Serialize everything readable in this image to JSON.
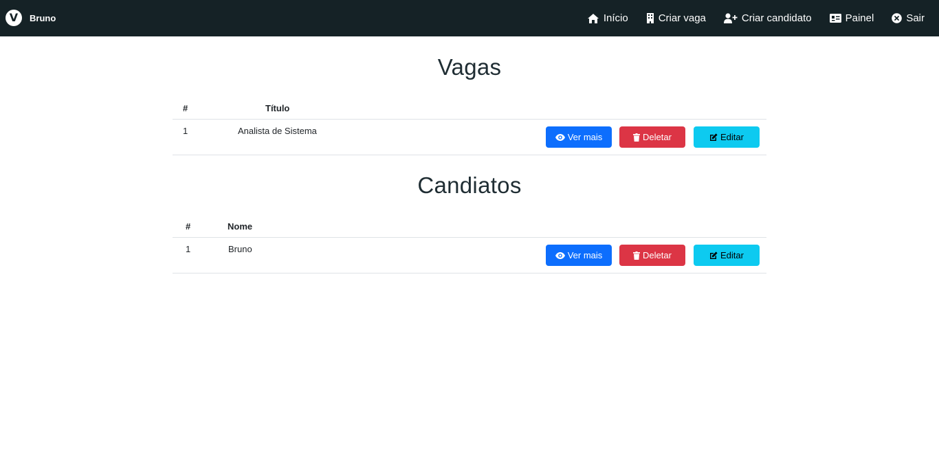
{
  "navbar": {
    "brand_letter": "V",
    "brand_name": "Bruno",
    "links": [
      {
        "label": "Início",
        "icon": "home-icon"
      },
      {
        "label": "Criar vaga",
        "icon": "building-icon"
      },
      {
        "label": "Criar candidato",
        "icon": "user-plus-icon"
      },
      {
        "label": "Painel",
        "icon": "id-card-icon"
      },
      {
        "label": "Sair",
        "icon": "close-circle-icon"
      }
    ]
  },
  "vagas": {
    "title": "Vagas",
    "headers": [
      "#",
      "Título"
    ],
    "rows": [
      {
        "id": "1",
        "value": "Analista de Sistema"
      }
    ]
  },
  "candidatos": {
    "title": "Candiatos",
    "headers": [
      "#",
      "Nome"
    ],
    "rows": [
      {
        "id": "1",
        "value": "Bruno"
      }
    ]
  },
  "actions": {
    "view": "Ver mais",
    "delete": "Deletar",
    "edit": "Editar"
  },
  "colors": {
    "navbar": "#152226",
    "primary": "#0d6efd",
    "danger": "#dc3545",
    "info": "#0dcaf0"
  }
}
